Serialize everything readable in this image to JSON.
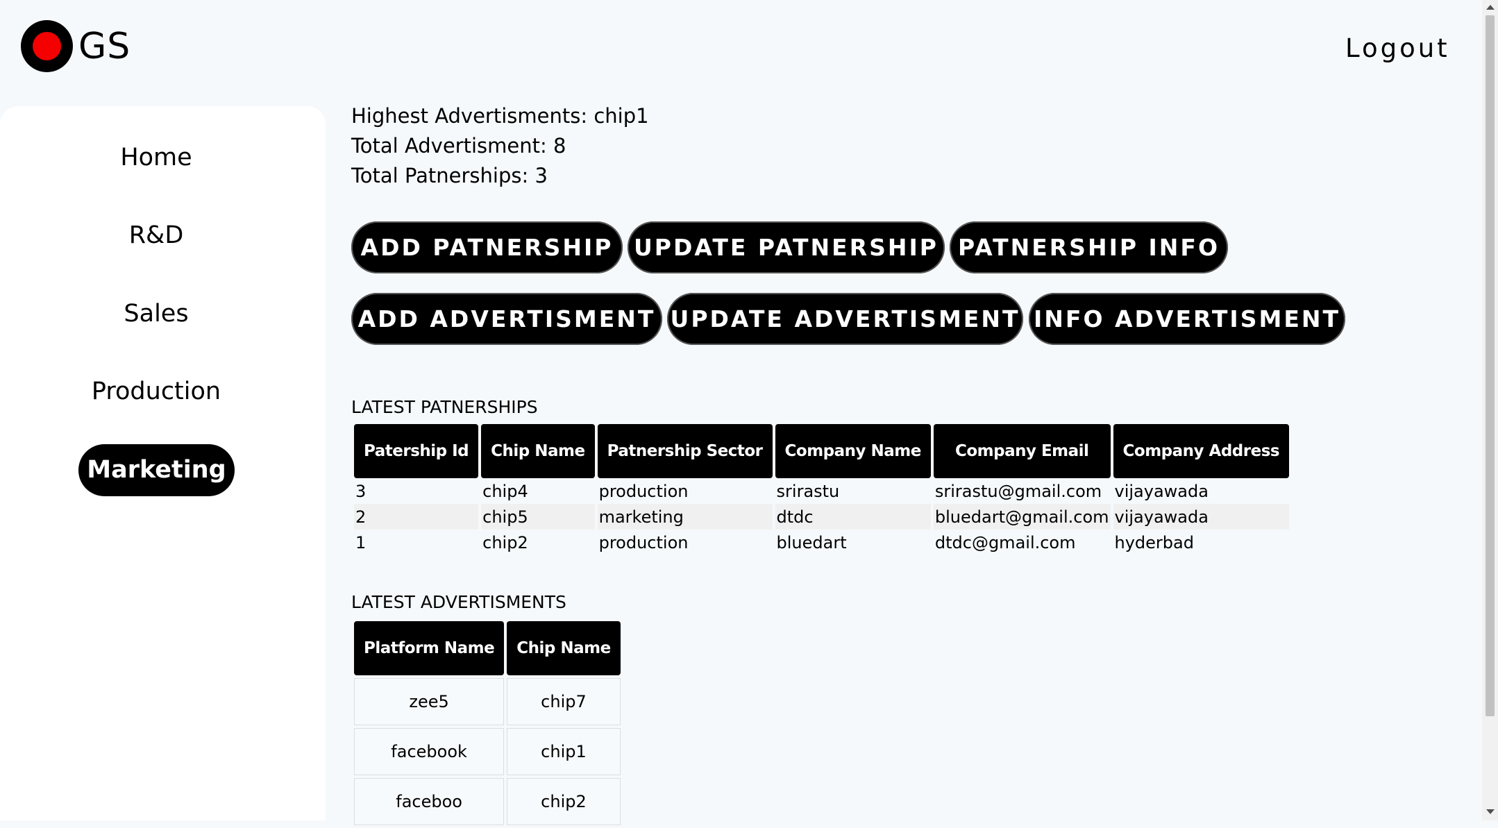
{
  "header": {
    "logo_text": "GS",
    "logout_label": "Logout"
  },
  "sidebar": {
    "items": [
      {
        "label": "Home"
      },
      {
        "label": "R&D"
      },
      {
        "label": "Sales"
      },
      {
        "label": "Production"
      },
      {
        "label": "Marketing",
        "active": true
      }
    ]
  },
  "stats": {
    "highest": "Highest Advertisments: chip1",
    "total_ads": "Total Advertisment: 8",
    "total_partnerships": "Total Patnerships: 3"
  },
  "actions": {
    "add_partnership": "ADD PATNERSHIP",
    "update_partnership": "UPDATE PATNERSHIP",
    "partnership_info": "PATNERSHIP INFO",
    "add_advertisment": "ADD ADVERTISMENT",
    "update_advertisment": "UPDATE ADVERTISMENT",
    "info_advertisment": "INFO ADVERTISMENT"
  },
  "partnerships": {
    "title": "LATEST PATNERSHIPS",
    "columns": [
      "Patership Id",
      "Chip Name",
      "Patnership Sector",
      "Company Name",
      "Company Email",
      "Company Address"
    ],
    "rows": [
      [
        "3",
        "chip4",
        "production",
        "srirastu",
        "srirastu@gmail.com",
        "vijayawada"
      ],
      [
        "2",
        "chip5",
        "marketing",
        "dtdc",
        "bluedart@gmail.com",
        "vijayawada"
      ],
      [
        "1",
        "chip2",
        "production",
        "bluedart",
        "dtdc@gmail.com",
        "hyderbad"
      ]
    ]
  },
  "advertisments": {
    "title": "LATEST ADVERTISMENTS",
    "columns": [
      "Platform Name",
      "Chip Name"
    ],
    "rows": [
      [
        "zee5",
        "chip7"
      ],
      [
        "facebook",
        "chip1"
      ],
      [
        "faceboo",
        "chip2"
      ]
    ]
  },
  "colors": {
    "background": "#f5f9fc",
    "logo_dot": "#f40000",
    "button": "#000000"
  }
}
